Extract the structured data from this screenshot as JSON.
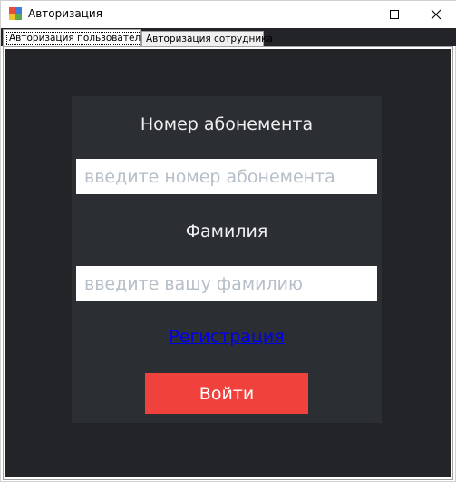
{
  "window": {
    "title": "Авторизация",
    "icon": "app-window-icon"
  },
  "tabs": [
    {
      "label": "Авторизация пользователя",
      "active": true
    },
    {
      "label": "Авторизация сотрудника",
      "active": false
    }
  ],
  "form": {
    "subscription_label": "Номер абонемента",
    "subscription_placeholder": "введите номер абонемента",
    "subscription_value": "",
    "surname_label": "Фамилия",
    "surname_placeholder": "введите вашу фамилию",
    "surname_value": "",
    "register_link": "Регистрация",
    "login_button": "Войти"
  },
  "colors": {
    "background": "#222428",
    "panel": "#2b2e33",
    "accent_button": "#f0413d",
    "link": "#0000ee"
  }
}
